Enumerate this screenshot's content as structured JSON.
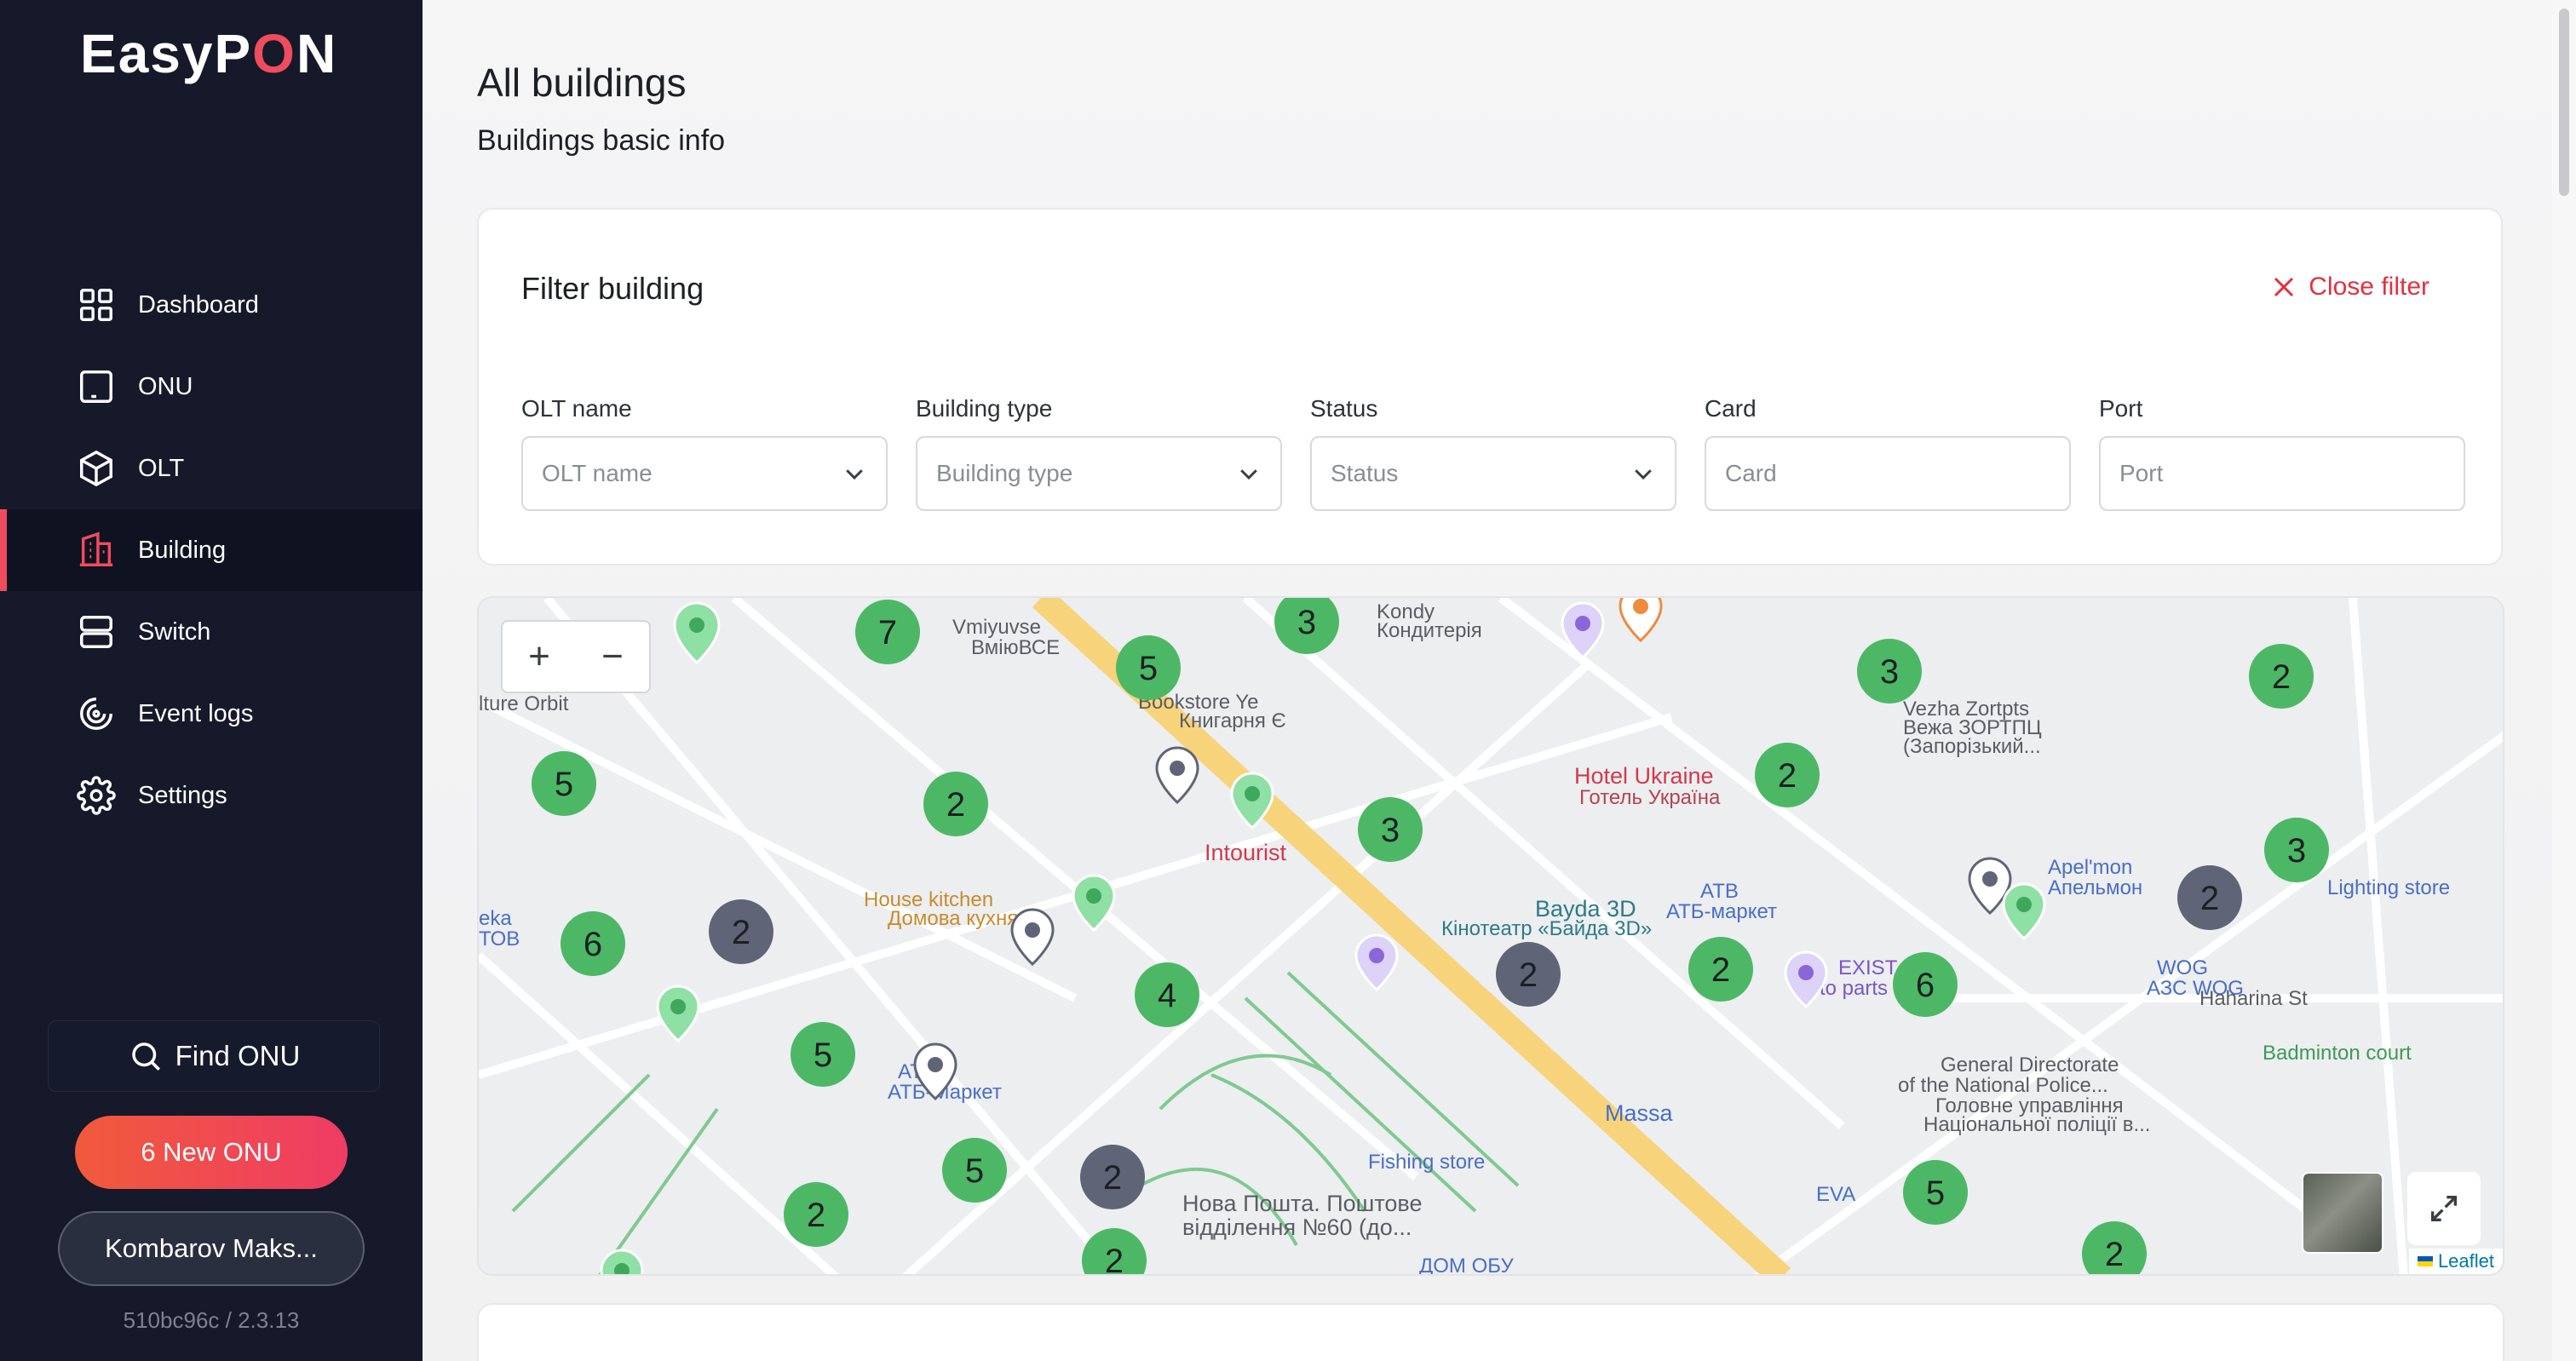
{
  "app": {
    "logo_prefix": "EasyP",
    "logo_o": "O",
    "logo_suffix": "N",
    "version": "510bc96c / 2.3.13"
  },
  "sidebar": {
    "items": [
      {
        "label": "Dashboard",
        "icon": "dashboard-icon",
        "active": false
      },
      {
        "label": "ONU",
        "icon": "onu-icon",
        "active": false
      },
      {
        "label": "OLT",
        "icon": "cube-icon",
        "active": false
      },
      {
        "label": "Building",
        "icon": "building-icon",
        "active": true
      },
      {
        "label": "Switch",
        "icon": "switch-icon",
        "active": false
      },
      {
        "label": "Event logs",
        "icon": "event-logs-icon",
        "active": false
      },
      {
        "label": "Settings",
        "icon": "gear-icon",
        "active": false
      }
    ],
    "find_onu": "Find ONU",
    "new_onu": "6 New ONU",
    "user": "Kombarov Maks..."
  },
  "page": {
    "title": "All buildings",
    "subtitle": "Buildings basic info"
  },
  "filter": {
    "title": "Filter building",
    "close_label": "Close filter",
    "fields": [
      {
        "label": "OLT name",
        "placeholder": "OLT name",
        "type": "select"
      },
      {
        "label": "Building type",
        "placeholder": "Building type",
        "type": "select"
      },
      {
        "label": "Status",
        "placeholder": "Status",
        "type": "select"
      },
      {
        "label": "Card",
        "placeholder": "Card",
        "type": "input"
      },
      {
        "label": "Port",
        "placeholder": "Port",
        "type": "input"
      }
    ]
  },
  "map": {
    "zoom_in": "+",
    "zoom_out": "−",
    "attribution": "Leaflet",
    "cluster_colors": {
      "green": "#4cb866",
      "gray": "#5f6576"
    },
    "clusters": [
      {
        "count": "7",
        "color": "green"
      },
      {
        "count": "5",
        "color": "green"
      },
      {
        "count": "3",
        "color": "green"
      },
      {
        "count": "3",
        "color": "green"
      },
      {
        "count": "2",
        "color": "green"
      },
      {
        "count": "5",
        "color": "green"
      },
      {
        "count": "2",
        "color": "green"
      },
      {
        "count": "3",
        "color": "green"
      },
      {
        "count": "2",
        "color": "green"
      },
      {
        "count": "3",
        "color": "green"
      },
      {
        "count": "6",
        "color": "green"
      },
      {
        "count": "2",
        "color": "gray"
      },
      {
        "count": "2",
        "color": "gray"
      },
      {
        "count": "2",
        "color": "gray"
      },
      {
        "count": "2",
        "color": "green"
      },
      {
        "count": "6",
        "color": "green"
      },
      {
        "count": "4",
        "color": "green"
      },
      {
        "count": "5",
        "color": "green"
      },
      {
        "count": "5",
        "color": "green"
      },
      {
        "count": "2",
        "color": "gray"
      },
      {
        "count": "2",
        "color": "green"
      },
      {
        "count": "5",
        "color": "green"
      },
      {
        "count": "2",
        "color": "green"
      },
      {
        "count": "2",
        "color": "green"
      }
    ],
    "labels": [
      "lture Orbit",
      "Vmiyuvse",
      "ВміюВСЕ",
      "Kondy",
      "Кондитерія",
      "Bookstore Ye",
      "Книгарня Є",
      "Hotel Ukraine",
      "Готель Україна",
      "Vezha Zortpts",
      "Вежа ЗОРТПЦ",
      "(Запорізький...",
      "Intourist",
      "House kitchen",
      "Домова кухня",
      "Bayda 3D",
      "Кінотеатр «Байда 3D»",
      "ATB",
      "АТБ-маркет",
      "Apel'mon",
      "Апельмон",
      "Lighting store",
      "EXIST",
      "to parts",
      "WOG",
      "АЗС WOG",
      "Haharina St",
      "General Directorate",
      "of the National Police...",
      "Головне управління",
      "Національної поліції в...",
      "Badminton court",
      "ATB",
      "АТБ-Маркет",
      "Fishing store",
      "Нова Пошта. Поштове",
      "відділення №60 (до...",
      "EVA",
      "Massa",
      "ДОМ ОБУ",
      "eka",
      "ТОВ"
    ]
  }
}
